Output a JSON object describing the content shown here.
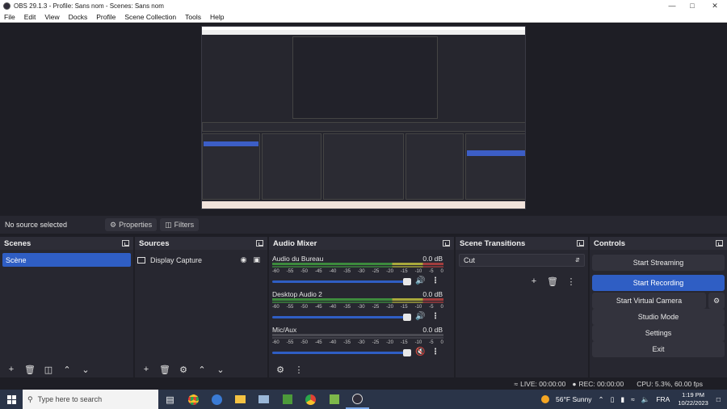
{
  "window": {
    "title": "OBS 29.1.3 - Profile: Sans nom - Scenes: Sans nom"
  },
  "menu": [
    "File",
    "Edit",
    "View",
    "Docks",
    "Profile",
    "Scene Collection",
    "Tools",
    "Help"
  ],
  "sourcebar": {
    "no_source": "No source selected",
    "properties": "Properties",
    "filters": "Filters"
  },
  "scenes": {
    "title": "Scenes",
    "items": [
      "Scène"
    ]
  },
  "sources": {
    "title": "Sources",
    "items": [
      "Display Capture"
    ]
  },
  "mixer": {
    "title": "Audio Mixer",
    "ticks": [
      "-60",
      "-55",
      "-50",
      "-45",
      "-40",
      "-35",
      "-30",
      "-25",
      "-20",
      "-15",
      "-10",
      "-5",
      "0"
    ],
    "channels": [
      {
        "name": "Audio du Bureau",
        "db": "0.0 dB",
        "muted": false
      },
      {
        "name": "Desktop Audio 2",
        "db": "0.0 dB",
        "muted": false
      },
      {
        "name": "Mic/Aux",
        "db": "0.0 dB",
        "muted": true
      }
    ]
  },
  "transitions": {
    "title": "Scene Transitions",
    "selected": "Cut"
  },
  "controls": {
    "title": "Controls",
    "buttons": [
      "Start Streaming",
      "Start Recording",
      "Start Virtual Camera",
      "Studio Mode",
      "Settings",
      "Exit"
    ]
  },
  "status": {
    "live": "LIVE: 00:00:00",
    "rec": "REC: 00:00:00",
    "cpu": "CPU: 5.3%, 60.00 fps"
  },
  "taskbar": {
    "search_placeholder": "Type here to search",
    "weather": "56°F  Sunny",
    "lang": "FRA",
    "time": "1:19 PM",
    "date": "10/22/2023"
  },
  "colors": {
    "accent": "#2f5ec4",
    "panel": "#272730",
    "bg": "#1e1e25"
  }
}
